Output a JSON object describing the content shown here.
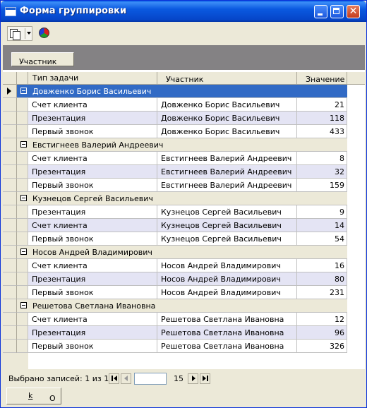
{
  "window": {
    "title": "Форма группировки"
  },
  "toolbar": {
    "copy_icon": "copy-icon",
    "chart_icon": "pie-chart-icon"
  },
  "group_panel": {
    "chip_label": "Участник"
  },
  "columns": {
    "task": "Тип задачи",
    "participant": "Участник",
    "value": "Значение"
  },
  "groups": [
    {
      "name": "Довженко Борис  Васильевич",
      "selected": true,
      "rows": [
        {
          "task": "Счет клиента",
          "participant": "Довженко Борис  Васильевич",
          "value": "21"
        },
        {
          "task": "Презентация",
          "participant": "Довженко Борис  Васильевич",
          "value": "118"
        },
        {
          "task": "Первый звонок",
          "participant": "Довженко Борис  Васильевич",
          "value": "433"
        }
      ]
    },
    {
      "name": "Евстигнеев Валерий Андреевич",
      "rows": [
        {
          "task": "Счет клиента",
          "participant": "Евстигнеев Валерий Андреевич",
          "value": "8"
        },
        {
          "task": "Презентация",
          "participant": "Евстигнеев Валерий Андреевич",
          "value": "32"
        },
        {
          "task": "Первый звонок",
          "participant": "Евстигнеев Валерий Андреевич",
          "value": "159"
        }
      ]
    },
    {
      "name": "Кузнецов Сергей Васильевич",
      "rows": [
        {
          "task": "Презентация",
          "participant": "Кузнецов Сергей Васильевич",
          "value": "9"
        },
        {
          "task": "Счет клиента",
          "participant": "Кузнецов Сергей Васильевич",
          "value": "14"
        },
        {
          "task": "Первый звонок",
          "participant": "Кузнецов Сергей Васильевич",
          "value": "54"
        }
      ]
    },
    {
      "name": "Носов Андрей Владимирович",
      "rows": [
        {
          "task": "Счет клиента",
          "participant": "Носов Андрей Владимирович",
          "value": "16"
        },
        {
          "task": "Презентация",
          "participant": "Носов Андрей Владимирович",
          "value": "80"
        },
        {
          "task": "Первый звонок",
          "participant": "Носов Андрей Владимирович",
          "value": "231"
        }
      ]
    },
    {
      "name": "Решетова Светлана Ивановна",
      "rows": [
        {
          "task": "Счет клиента",
          "participant": "Решетова Светлана Ивановна",
          "value": "12"
        },
        {
          "task": "Презентация",
          "participant": "Решетова Светлана Ивановна",
          "value": "96"
        },
        {
          "task": "Первый звонок",
          "participant": "Решетова Светлана Ивановна",
          "value": "326"
        }
      ]
    }
  ],
  "navigator": {
    "label": "Выбрано записей: 1 из 15",
    "page_value": "",
    "total": "15"
  },
  "buttons": {
    "ok_prefix": "О",
    "ok_hotkey": "k"
  },
  "colors": {
    "selection": "#316ac5",
    "alt_row": "#e4e4f4",
    "group_header": "#ece9d8"
  }
}
